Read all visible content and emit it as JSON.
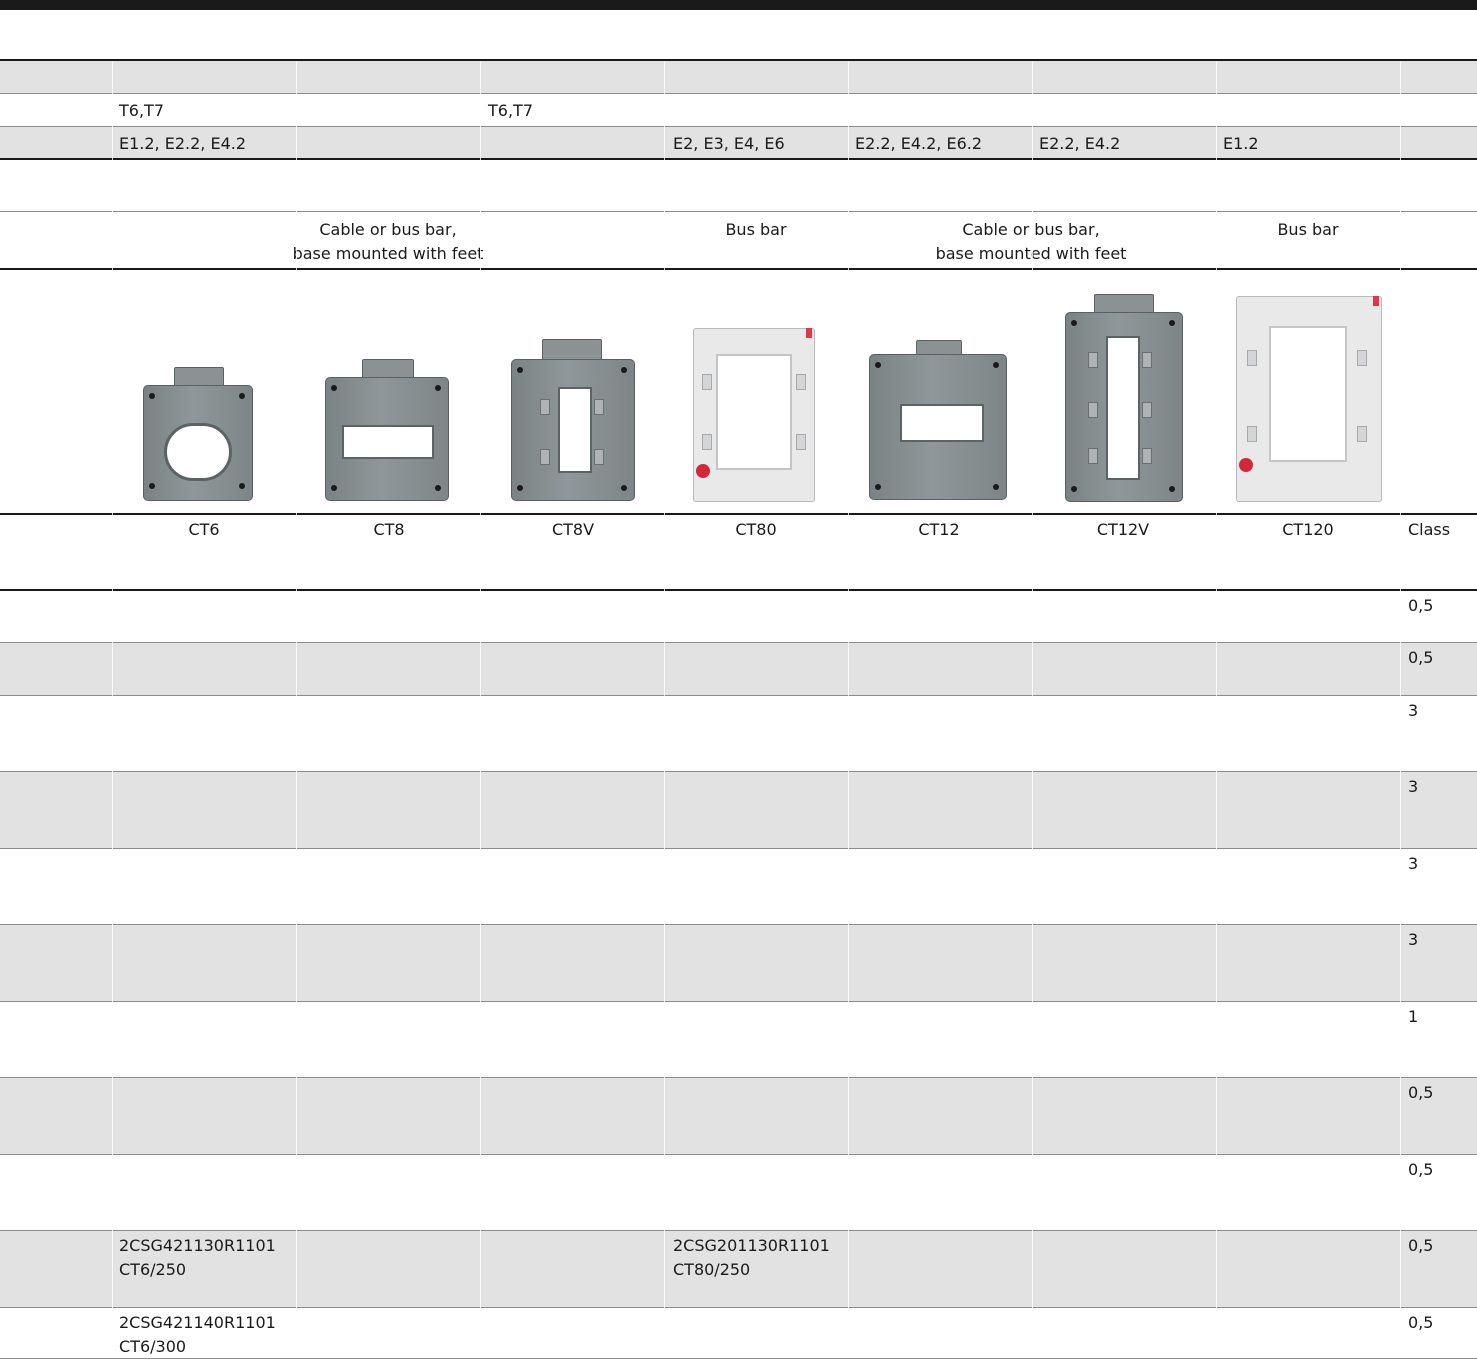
{
  "breakers": {
    "tmax": [
      "T6,T7",
      "T6,T7"
    ],
    "emax": [
      "E1.2, E2.2, E4.2",
      "E2, E3, E4, E6",
      "E2.2, E4.2, E6.2",
      "E2.2, E4.2",
      "E1.2"
    ]
  },
  "mounting": [
    "Cable or bus bar,\nbase mounted with feet",
    "Bus bar",
    "Cable or bus bar,\nbase mounted with feet",
    "Bus bar"
  ],
  "products": [
    {
      "model": "CT6",
      "style": "dark",
      "window": "round"
    },
    {
      "model": "CT8",
      "style": "dark",
      "window": "wide"
    },
    {
      "model": "CT8V",
      "style": "dark",
      "window": "tall"
    },
    {
      "model": "CT80",
      "style": "light",
      "window": "frame"
    },
    {
      "model": "CT12",
      "style": "dark",
      "window": "wide"
    },
    {
      "model": "CT12V",
      "style": "dark",
      "window": "tall"
    },
    {
      "model": "CT120",
      "style": "light",
      "window": "frame"
    }
  ],
  "class_header": "Class",
  "rows": [
    {
      "class": "0,5",
      "ct6": "",
      "ct80": ""
    },
    {
      "class": "0,5",
      "ct6": "",
      "ct80": ""
    },
    {
      "class": "3",
      "ct6": "",
      "ct80": ""
    },
    {
      "class": "3",
      "ct6": "",
      "ct80": ""
    },
    {
      "class": "3",
      "ct6": "",
      "ct80": ""
    },
    {
      "class": "3",
      "ct6": "",
      "ct80": ""
    },
    {
      "class": "1",
      "ct6": "",
      "ct80": ""
    },
    {
      "class": "0,5",
      "ct6": "",
      "ct80": ""
    },
    {
      "class": "0,5",
      "ct6": "",
      "ct80": ""
    },
    {
      "class": "0,5",
      "ct6": "2CSG421130R1101\nCT6/250",
      "ct80": "2CSG201130R1101\nCT80/250"
    },
    {
      "class": "0,5",
      "ct6": "2CSG421140R1101\nCT6/300",
      "ct80": ""
    }
  ],
  "colors": {
    "rule": "#1a1a1a",
    "band": "#e2e2e2",
    "accent_red": "#d2283a"
  }
}
